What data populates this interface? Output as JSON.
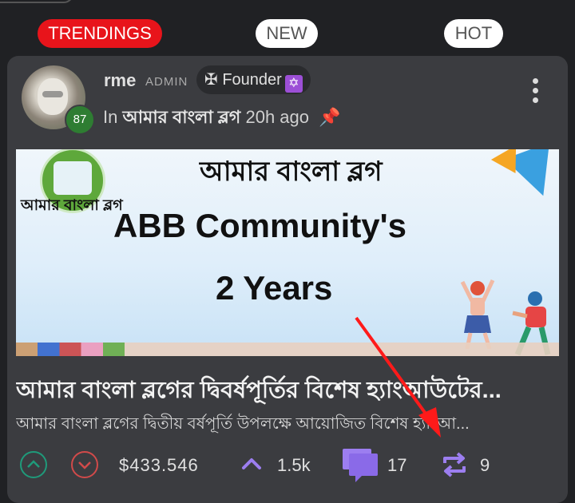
{
  "tabs": [
    {
      "label": "TRENDINGS",
      "active": true
    },
    {
      "label": "NEW",
      "active": false
    },
    {
      "label": "HOT",
      "active": false
    }
  ],
  "post": {
    "author": {
      "username": "rme",
      "role": "ADMIN",
      "badge": "✠ Founder",
      "level": "87"
    },
    "community_prefix": "In",
    "community": "আমার বাংলা ব্লগ",
    "time_ago": "20h ago",
    "banner": {
      "logo_text": "আমার বাংলা ব্লগ",
      "top_title": "আমার বাংলা ব্লগ",
      "main_title": "ABB Community's",
      "years": "2 Years"
    },
    "title": "আমার বাংলা ব্লগের দ্বিবর্ষপূর্তির বিশেষ হ্যাংআউটের...",
    "excerpt": "আমার বাংলা ব্লগের দ্বিতীয় বর্ষপূর্তি উপলক্ষে আয়োজিত বিশেষ হ্যাংআ...",
    "payout": "$433.546",
    "votes": "1.5k",
    "comments": "17",
    "reblogs": "9"
  },
  "colors": {
    "active_tab": "#e8141b",
    "upvote": "#1f9a7a",
    "downvote": "#d14a4a",
    "accent_purple": "#9c7ef0",
    "level_badge": "#2e7d32"
  }
}
